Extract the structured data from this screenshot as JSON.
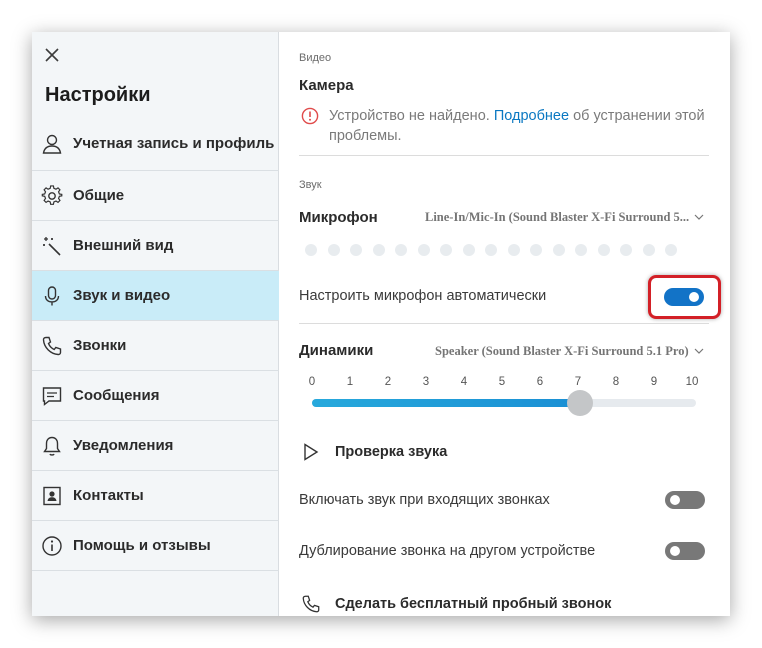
{
  "sidebar": {
    "title": "Настройки",
    "items": [
      {
        "label": "Учетная запись и профиль",
        "icon": "person-icon",
        "active": false
      },
      {
        "label": "Общие",
        "icon": "gear-icon",
        "active": false
      },
      {
        "label": "Внешний вид",
        "icon": "magic-wand-icon",
        "active": false
      },
      {
        "label": "Звук и видео",
        "icon": "microphone-icon",
        "active": true
      },
      {
        "label": "Звонки",
        "icon": "phone-icon",
        "active": false
      },
      {
        "label": "Сообщения",
        "icon": "message-icon",
        "active": false
      },
      {
        "label": "Уведомления",
        "icon": "bell-icon",
        "active": false
      },
      {
        "label": "Контакты",
        "icon": "contacts-icon",
        "active": false
      },
      {
        "label": "Помощь и отзывы",
        "icon": "info-icon",
        "active": false
      }
    ]
  },
  "video": {
    "section_label": "Видео",
    "camera_heading": "Камера",
    "warning_prefix": "Устройство не найдено.",
    "warning_link": "Подробнее",
    "warning_suffix": "об устранении этой проблемы."
  },
  "sound": {
    "section_label": "Звук",
    "microphone_heading": "Микрофон",
    "microphone_device": "Line-In/Mic-In (Sound Blaster X-Fi Surround 5...",
    "mic_level_dots": 17,
    "auto_mic_label": "Настроить микрофон автоматически",
    "auto_mic_on": true,
    "speakers_heading": "Динамики",
    "speakers_device": "Speaker (Sound Blaster X-Fi Surround 5.1 Pro)",
    "volume_ticks": [
      "0",
      "1",
      "2",
      "3",
      "4",
      "5",
      "6",
      "7",
      "8",
      "9",
      "10"
    ],
    "volume_value": 7,
    "test_sound_label": "Проверка звука",
    "incoming_label": "Включать звук при входящих звонках",
    "incoming_on": false,
    "duplicate_label": "Дублирование звонка на другом устройстве",
    "duplicate_on": false,
    "test_call_label": "Сделать бесплатный пробный звонок"
  },
  "colors": {
    "accent": "#1273c7",
    "active_nav": "#c9ecf8",
    "link": "#0a78c2",
    "highlight": "#d32027",
    "warning": "#e04b4b"
  }
}
